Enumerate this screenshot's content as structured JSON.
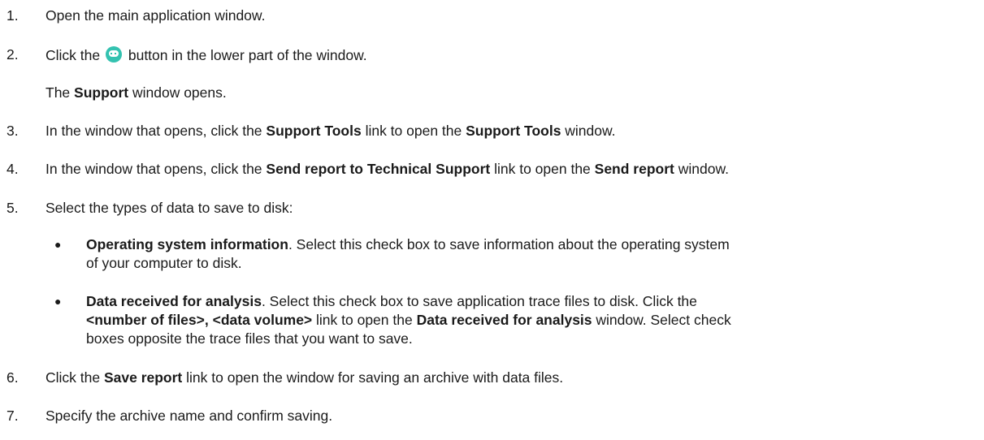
{
  "steps": [
    {
      "num": "1.",
      "parts": [
        "Open the main application window."
      ]
    },
    {
      "num": "2.",
      "before": "Click the",
      "icon": "support-agent-icon",
      "after": "button in the lower part of the window."
    },
    {
      "note": [
        "The ",
        "Support",
        " window opens."
      ]
    },
    {
      "num": "3.",
      "parts": [
        "In the window that opens, click the ",
        "Support Tools",
        " link to open the ",
        "Support Tools",
        " window."
      ]
    },
    {
      "num": "4.",
      "parts": [
        "In the window that opens, click the ",
        "Send report to Technical Support",
        " link to open the ",
        "Send report",
        " window."
      ]
    },
    {
      "num": "5.",
      "parts": [
        "Select the types of data to save to disk:"
      ]
    },
    {
      "bullets": [
        {
          "line1": [
            "Operating system information",
            ". Select this check box to save information about the operating system"
          ],
          "line2": [
            "of your computer to disk."
          ]
        },
        {
          "line1": [
            "Data received for analysis",
            ". Select this check box to save application trace files to disk. Click the"
          ],
          "line2": [
            "<number of files>, <data volume>",
            " link to open the ",
            "Data received for analysis",
            " window. Select check"
          ],
          "line3": [
            "boxes opposite the trace files that you want to save."
          ]
        }
      ]
    },
    {
      "num": "6.",
      "parts": [
        "Click the ",
        "Save report",
        " link to open the window for saving an archive with data files."
      ]
    },
    {
      "num": "7.",
      "parts": [
        "Specify the archive name and confirm saving."
      ]
    }
  ]
}
